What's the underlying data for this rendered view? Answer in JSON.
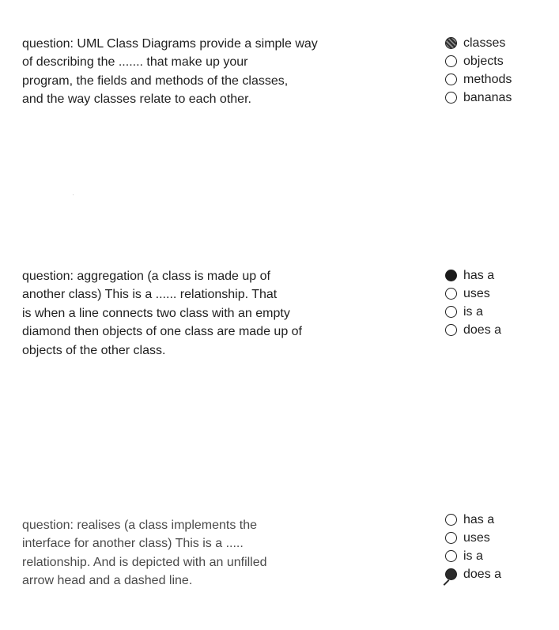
{
  "questions": [
    {
      "text": "question: UML Class Diagrams provide a simple way\nof describing the ....... that make up your\nprogram, the fields and methods of the classes,\nand the way classes relate to each other.",
      "options": [
        "classes",
        "objects",
        "methods",
        "bananas"
      ],
      "selected_index": 0
    },
    {
      "text": "question: aggregation (a class is made up of\nanother class) This is a ...... relationship. That\nis when a line connects two class with an empty\ndiamond then objects of one class are made up of\nobjects of the other class.",
      "options": [
        "has a",
        "uses",
        "is a",
        "does a"
      ],
      "selected_index": 0
    },
    {
      "text": "question: realises (a class implements the\ninterface for another class) This is a .....\nrelationship. And is depicted with an unfilled\narrow head and a dashed line.",
      "options": [
        "has a",
        "uses",
        "is a",
        "does a"
      ],
      "selected_index": 3
    }
  ]
}
